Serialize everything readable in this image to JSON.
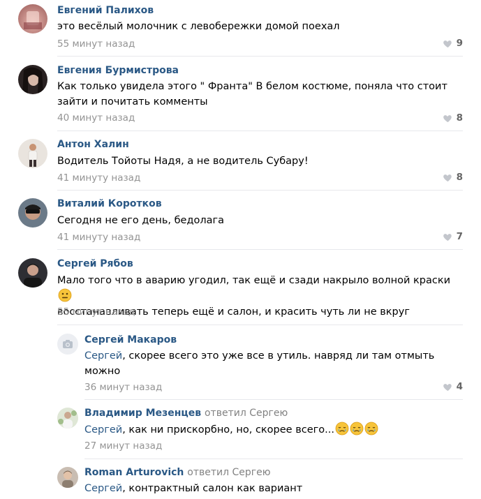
{
  "comments": [
    {
      "author": "Евгений Палихов",
      "text": "это весёлый молочник с левобережки домой поехал",
      "time": "55 минут назад",
      "likes": "9"
    },
    {
      "author": "Евгения Бурмистрова",
      "text_line1": "Как только увидела этого \" Франта\" В белом костюме, поняла что стоит",
      "text_line2": "зайти и почитать комменты",
      "time": "40 минут назад",
      "likes": "8"
    },
    {
      "author": "Антон Халин",
      "text": "Водитель Тойоты Надя, а не водитель Субару!",
      "time": "41 минуту назад",
      "likes": "8"
    },
    {
      "author": "Виталий Коротков",
      "text": "Сегодня не его день, бедолага",
      "time": "41 минуту назад",
      "likes": "7"
    },
    {
      "author": "Сергей Рябов",
      "text_line1": "Мало того что в аварию угодил, так ещё и сзади накрыло волной краски",
      "text_line2": "восстанавливать теперь ещё и салон, и красить чуть ли не вкруг",
      "time": "55 минут назад"
    }
  ],
  "replies": [
    {
      "author": "Сергей Макаров",
      "addressee": "Сергей",
      "text_line1": ", скорее всего это уже все в утиль. навряд ли там отмыть",
      "text_line2": "можно",
      "time": "36 минут назад",
      "likes": "4"
    },
    {
      "author": "Владимир Мезенцев",
      "replied": "ответил Сергею",
      "addressee": "Сергей",
      "text": ", как ни прискорбно, но, скорее всего...",
      "time": "27 минут назад"
    },
    {
      "author": "Roman Arturovich",
      "replied": "ответил Сергею",
      "addressee": "Сергей",
      "text": ", контрактный салон как вариант"
    }
  ],
  "colors": {
    "link": "#2a5885",
    "muted": "#939393",
    "separator": "#e7e8ec",
    "heart": "#c3c6cc"
  }
}
